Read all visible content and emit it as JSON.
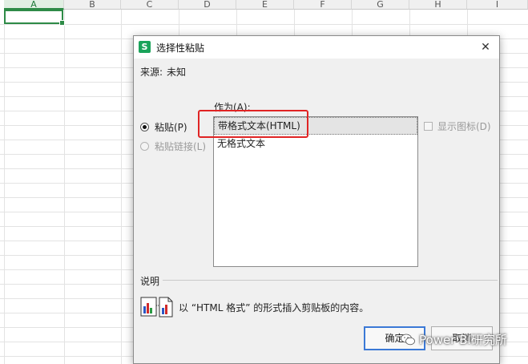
{
  "spreadsheet": {
    "columns": [
      "A",
      "B",
      "C",
      "D",
      "E",
      "F",
      "G",
      "H",
      "I"
    ],
    "active_column": "A",
    "active_cell": "A1"
  },
  "dialog": {
    "title": "选择性粘贴",
    "app_icon_glyph": "S",
    "close_glyph": "✕",
    "source_label": "来源:",
    "source_value": "未知",
    "paste_label": "粘贴(P)",
    "paste_link_label": "粘贴链接(L)",
    "as_label": "作为(A):",
    "options": [
      "带格式文本(HTML)",
      "无格式文本"
    ],
    "selected_option": "带格式文本(HTML)",
    "show_icon_label": "显示图标(D)",
    "description_title": "说明",
    "description_text": "以 “HTML 格式” 的形式插入剪贴板的内容。",
    "ok_label": "确定",
    "cancel_label": "取消"
  },
  "watermark": {
    "text": "Power BI研究所"
  },
  "colors": {
    "accent_green": "#2e8b47",
    "highlight_red": "#e02424",
    "button_focus_blue": "#3b79d6"
  }
}
